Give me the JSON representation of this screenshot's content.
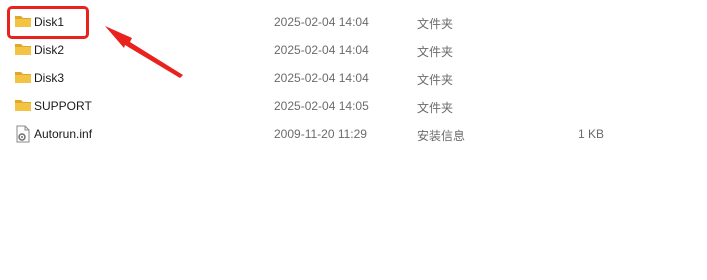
{
  "files": [
    {
      "name": "Disk1",
      "date": "2025-02-04 14:04",
      "type": "文件夹",
      "size": "",
      "icon": "folder-icon"
    },
    {
      "name": "Disk2",
      "date": "2025-02-04 14:04",
      "type": "文件夹",
      "size": "",
      "icon": "folder-icon"
    },
    {
      "name": "Disk3",
      "date": "2025-02-04 14:04",
      "type": "文件夹",
      "size": "",
      "icon": "folder-icon"
    },
    {
      "name": "SUPPORT",
      "date": "2025-02-04 14:05",
      "type": "文件夹",
      "size": "",
      "icon": "folder-icon"
    },
    {
      "name": "Autorun.inf",
      "date": "2009-11-20 11:29",
      "type": "安装信息",
      "size": "1 KB",
      "icon": "settings-file-icon"
    }
  ],
  "annotation": {
    "color": "#e8221c",
    "highlighted_item": "Disk1",
    "arrow_icon": "red-arrow-icon"
  },
  "colors": {
    "folder": "#f3c443",
    "folder_dark": "#e0a82a",
    "secondary_text": "#6b6b6b"
  }
}
